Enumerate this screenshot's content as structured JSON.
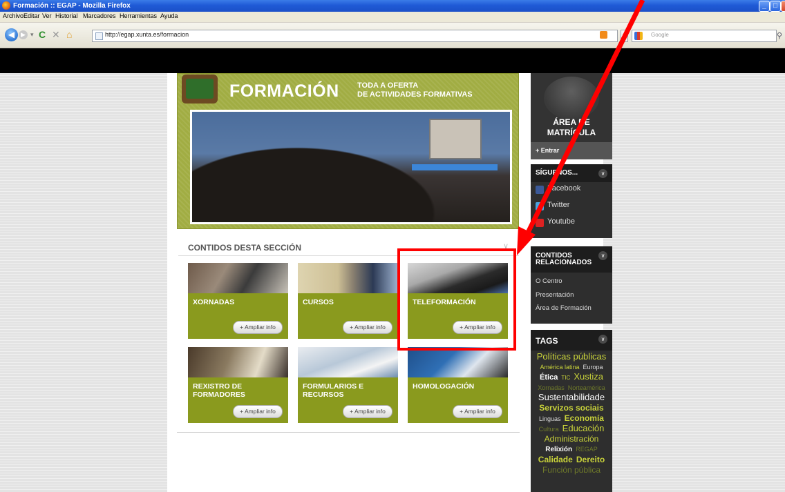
{
  "browser": {
    "window_title": "Formación :: EGAP - Mozilla Firefox",
    "menu": [
      "Archivo",
      "Editar",
      "Ver",
      "Historial",
      "Marcadores",
      "Herramientas",
      "Ayuda"
    ],
    "url": "http://egap.xunta.es/formacion",
    "search_placeholder": "Google"
  },
  "banner": {
    "title": "FORMACIÓN",
    "subtitle_line1": "TODA A OFERTA",
    "subtitle_line2": "DE ACTIVIDADES FORMATIVAS"
  },
  "section": {
    "title": "CONTIDOS DESTA SECCIÓN",
    "more_label": "+ Ampliar info",
    "cards": [
      {
        "label": "XORNADAS"
      },
      {
        "label": "CURSOS"
      },
      {
        "label": "TELEFORMACIÓN"
      },
      {
        "label": "REXISTRO DE\nFORMADORES"
      },
      {
        "label": "FORMULARIOS E\nRECURSOS"
      },
      {
        "label": "HOMOLOGACIÓN"
      }
    ]
  },
  "sidebar": {
    "matricula": {
      "line1": "ÁREA DE",
      "line2": "MATRÍCULA",
      "enter": "+ Entrar"
    },
    "social": {
      "title": "SÍGUENOS...",
      "items": [
        "Facebook",
        "Twitter",
        "Youtube"
      ]
    },
    "related": {
      "title_line1": "CONTIDOS",
      "title_line2": "RELACIONADOS",
      "items": [
        "O Centro",
        "Presentación",
        "Área de Formación"
      ]
    },
    "tags": {
      "title": "TAGS",
      "cloud": [
        {
          "text": "Políticas públicas",
          "size": 13,
          "color": "#c9d33a",
          "bold": false
        },
        {
          "text": "América latina",
          "size": 9,
          "color": "#c9d33a",
          "bold": false
        },
        {
          "text": "Europa",
          "size": 9,
          "color": "#dddddd",
          "bold": false
        },
        {
          "text": "Ética",
          "size": 11,
          "color": "#ffffff",
          "bold": true
        },
        {
          "text": "TIC",
          "size": 8,
          "color": "#c9d33a",
          "bold": false
        },
        {
          "text": "Xustiza",
          "size": 13,
          "color": "#c9d33a",
          "bold": false
        },
        {
          "text": "Xornadas",
          "size": 9,
          "color": "#6f7a2a",
          "bold": false
        },
        {
          "text": "Norteamérica",
          "size": 9,
          "color": "#6f7a2a",
          "bold": false
        },
        {
          "text": "Sustentabilidade",
          "size": 13,
          "color": "#ffffff",
          "bold": false
        },
        {
          "text": "Servizos sociais",
          "size": 12,
          "color": "#c9d33a",
          "bold": true
        },
        {
          "text": "Linguas",
          "size": 9,
          "color": "#dddddd",
          "bold": false
        },
        {
          "text": "Economía",
          "size": 12,
          "color": "#c9d33a",
          "bold": true
        },
        {
          "text": "Cultura",
          "size": 9,
          "color": "#6f7a2a",
          "bold": false
        },
        {
          "text": "Educación",
          "size": 13,
          "color": "#c9d33a",
          "bold": false
        },
        {
          "text": "Administración",
          "size": 12,
          "color": "#c9d33a",
          "bold": false
        },
        {
          "text": "Relixión",
          "size": 10,
          "color": "#ffffff",
          "bold": true
        },
        {
          "text": "REGAP",
          "size": 9,
          "color": "#6f7a2a",
          "bold": false
        },
        {
          "text": "Calidade",
          "size": 12,
          "color": "#c9d33a",
          "bold": true
        },
        {
          "text": "Dereito",
          "size": 12,
          "color": "#c9d33a",
          "bold": true
        },
        {
          "text": "Función pública",
          "size": 12,
          "color": "#6f7a2a",
          "bold": false
        }
      ]
    }
  },
  "colors": {
    "accent_green": "#8a9a1e",
    "annotation_red": "#ff0000",
    "sidebar_dark": "#2e2e2e"
  }
}
